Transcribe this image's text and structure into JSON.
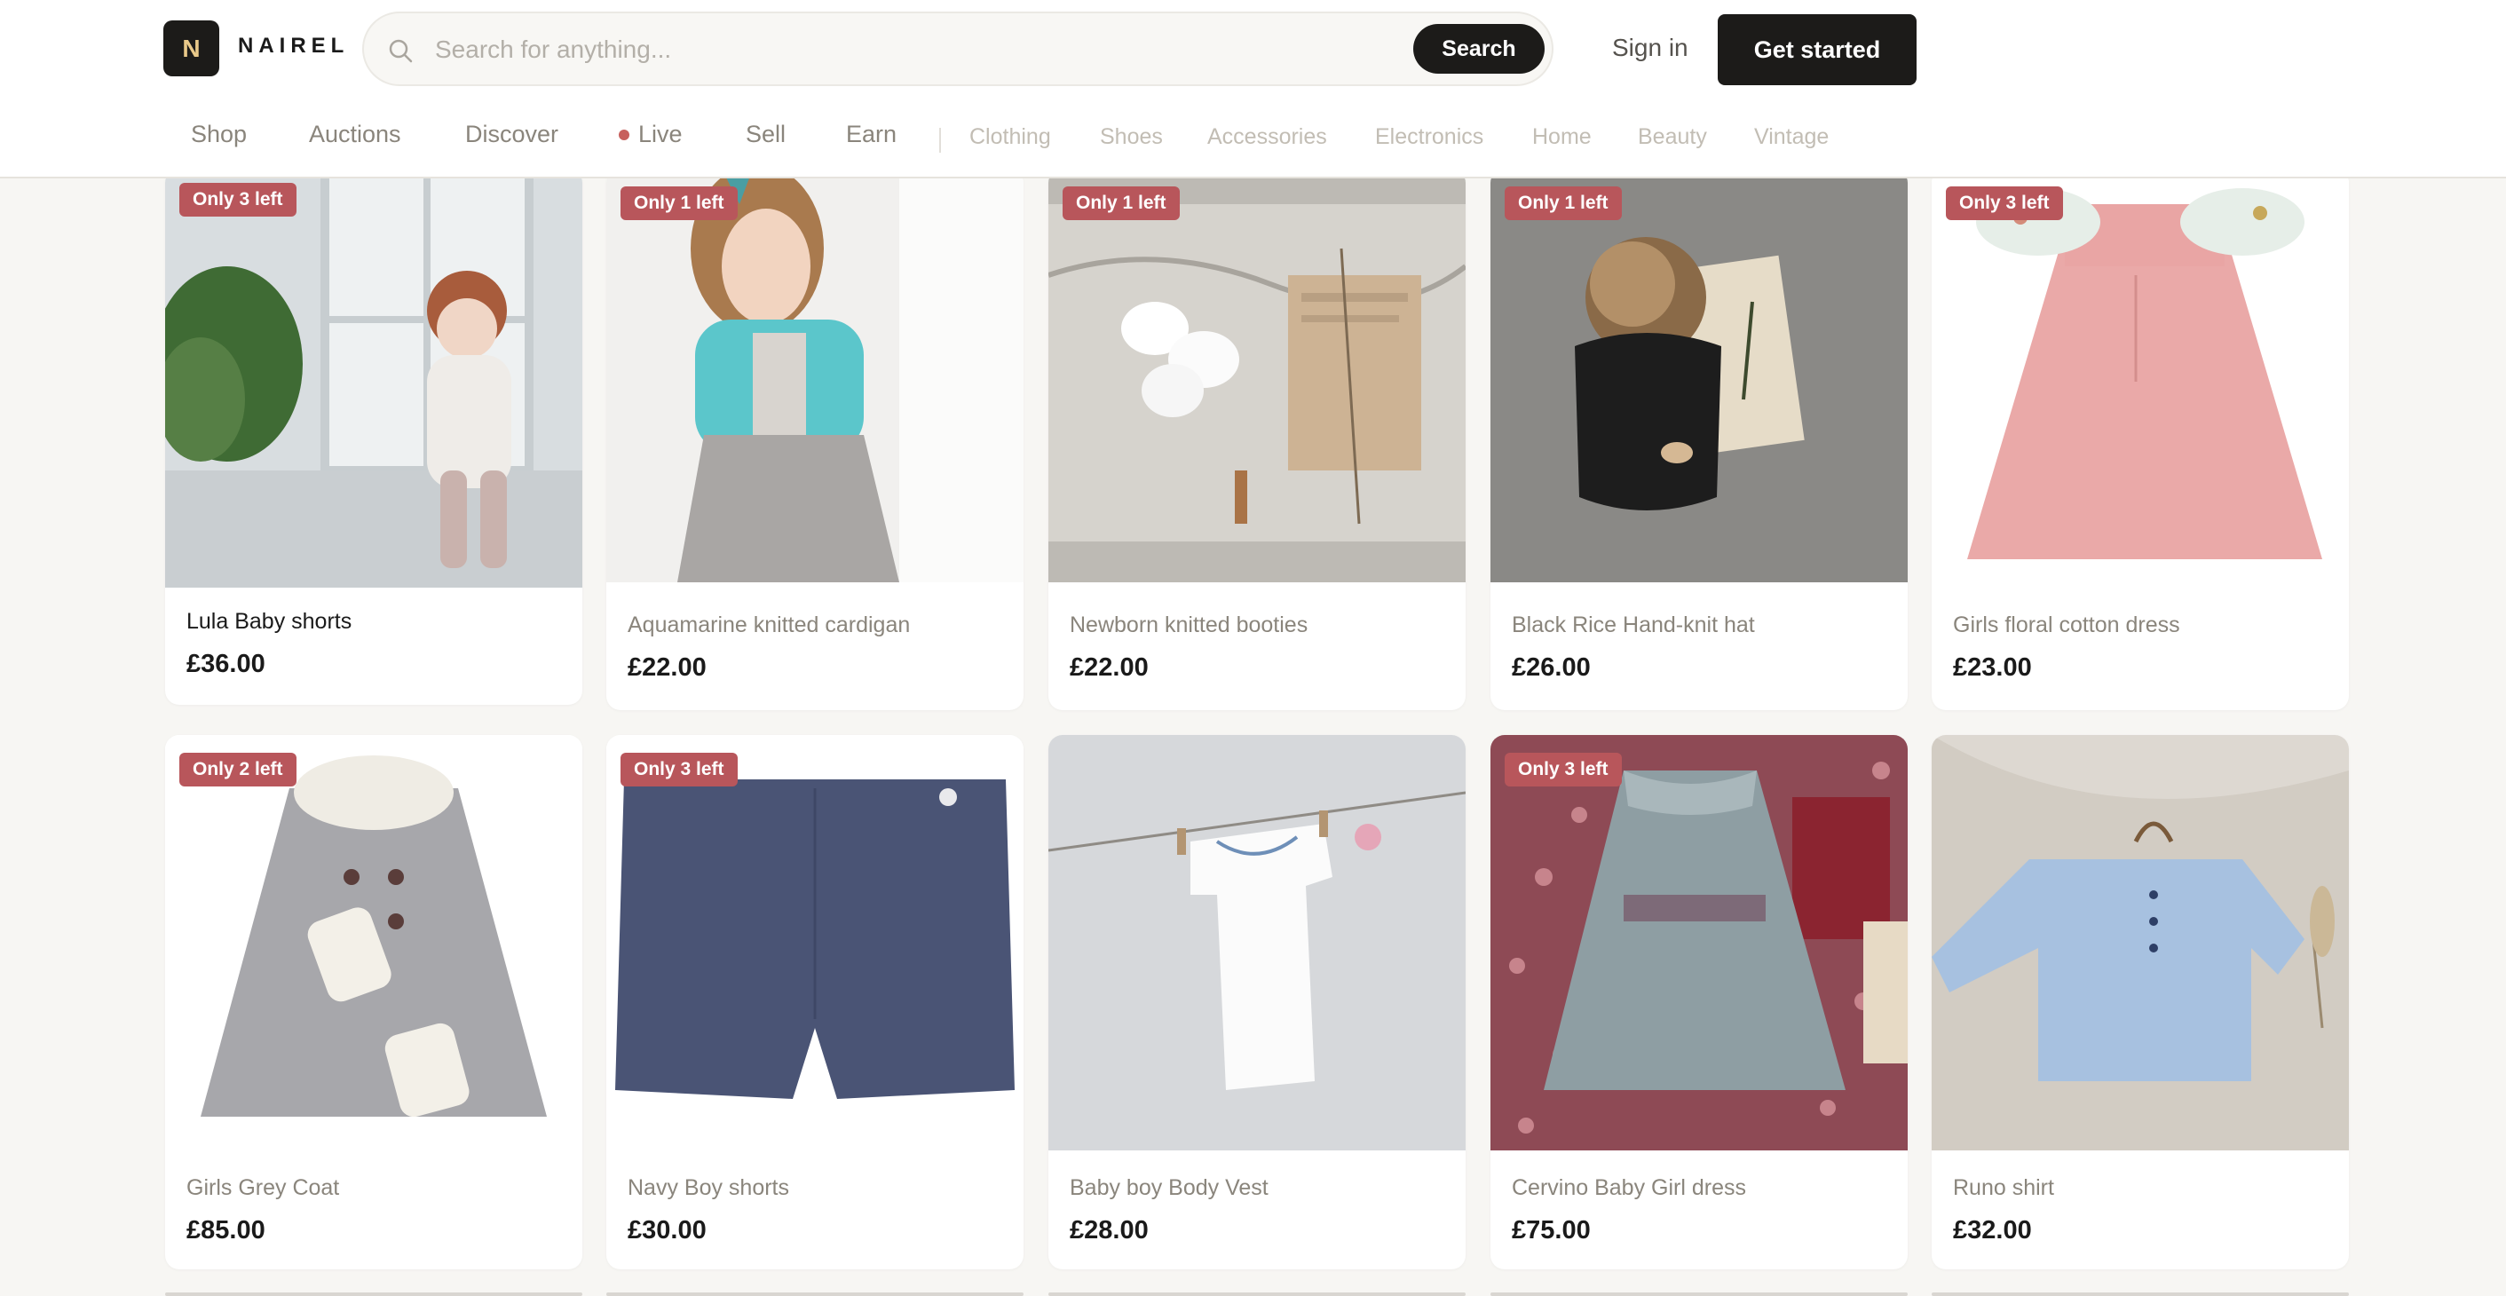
{
  "brand": {
    "logo_letter": "N",
    "name": "NAIREL"
  },
  "search": {
    "placeholder": "Search for anything...",
    "button": "Search"
  },
  "auth": {
    "sign_in": "Sign in",
    "get_started": "Get started"
  },
  "nav": {
    "primary": [
      "Shop",
      "Auctions",
      "Discover",
      "Live",
      "Sell",
      "Earn"
    ],
    "categories": [
      "Clothing",
      "Shoes",
      "Accessories",
      "Electronics",
      "Home",
      "Beauty",
      "Vintage"
    ]
  },
  "colors": {
    "accent": "#1c1b19",
    "badge": "#b8565b",
    "live_dot": "#c7605d",
    "background": "#f7f6f3"
  },
  "products": [
    {
      "title": "Lula Baby shorts",
      "price": "£36.00",
      "badge": "Only 3 left"
    },
    {
      "title": "Aquamarine knitted cardigan",
      "price": "£22.00",
      "badge": "Only 1 left"
    },
    {
      "title": "Newborn knitted booties",
      "price": "£22.00",
      "badge": "Only 1 left"
    },
    {
      "title": "Black Rice Hand-knit hat",
      "price": "£26.00",
      "badge": "Only 1 left"
    },
    {
      "title": "Girls floral cotton dress",
      "price": "£23.00",
      "badge": "Only 3 left"
    },
    {
      "title": "Girls Grey Coat",
      "price": "£85.00",
      "badge": "Only 2 left"
    },
    {
      "title": "Navy Boy shorts",
      "price": "£30.00",
      "badge": "Only 3 left"
    },
    {
      "title": "Baby boy Body Vest",
      "price": "£28.00",
      "badge": ""
    },
    {
      "title": "Cervino Baby Girl dress",
      "price": "£75.00",
      "badge": "Only 3 left"
    },
    {
      "title": "Runo shirt",
      "price": "£32.00",
      "badge": ""
    }
  ]
}
